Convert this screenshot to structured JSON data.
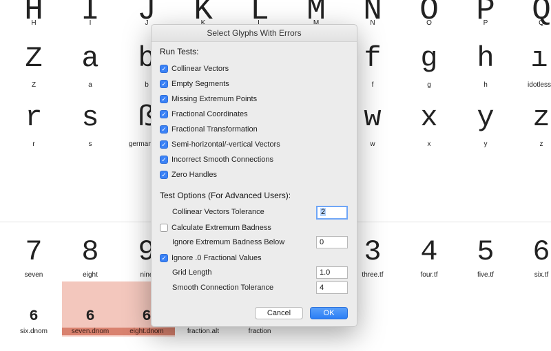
{
  "glyph_rows": {
    "top": [
      {
        "glyph": "H",
        "name": "H"
      },
      {
        "glyph": "I",
        "name": "I"
      },
      {
        "glyph": "J",
        "name": "J"
      },
      {
        "glyph": "K",
        "name": "K"
      },
      {
        "glyph": "L",
        "name": "L"
      },
      {
        "glyph": "M",
        "name": "M"
      },
      {
        "glyph": "N",
        "name": "N"
      },
      {
        "glyph": "O",
        "name": "O"
      },
      {
        "glyph": "P",
        "name": "P"
      },
      {
        "glyph": "Q",
        "name": "Q"
      }
    ],
    "second": [
      {
        "glyph": "Z",
        "name": "Z"
      },
      {
        "glyph": "a",
        "name": "a"
      },
      {
        "glyph": "b",
        "name": "b"
      },
      {
        "glyph": "f",
        "name": "f"
      },
      {
        "glyph": "g",
        "name": "g"
      },
      {
        "glyph": "h",
        "name": "h"
      },
      {
        "glyph": "ı",
        "name": "idotless"
      }
    ],
    "third": [
      {
        "glyph": "r",
        "name": "r"
      },
      {
        "glyph": "s",
        "name": "s"
      },
      {
        "glyph": "ß",
        "name": "germandbls"
      },
      {
        "glyph": "w",
        "name": "w"
      },
      {
        "glyph": "x",
        "name": "x"
      },
      {
        "glyph": "y",
        "name": "y"
      },
      {
        "glyph": "z",
        "name": "z"
      }
    ],
    "numbers": [
      {
        "glyph": "7",
        "name": "seven"
      },
      {
        "glyph": "8",
        "name": "eight"
      },
      {
        "glyph": "9",
        "name": "nine"
      },
      {
        "glyph": "3",
        "name": "three.tf"
      },
      {
        "glyph": "4",
        "name": "four.tf"
      },
      {
        "glyph": "5",
        "name": "five.tf"
      },
      {
        "glyph": "6",
        "name": "six.tf"
      }
    ],
    "denoms": [
      {
        "glyph": "6",
        "name": "six.dnom"
      },
      {
        "glyph": "6",
        "name": "seven.dnom"
      },
      {
        "glyph": "6",
        "name": "eight.dnom"
      },
      {
        "glyph": "",
        "name": "fraction.alt"
      },
      {
        "glyph": "",
        "name": "fraction"
      }
    ]
  },
  "highlight_color": "#f3c7bd",
  "dialog": {
    "title": "Select Glyphs With Errors",
    "run_tests_label": "Run Tests:",
    "tests": [
      {
        "label": "Collinear Vectors",
        "checked": true
      },
      {
        "label": "Empty Segments",
        "checked": true
      },
      {
        "label": "Missing Extremum Points",
        "checked": true
      },
      {
        "label": "Fractional Coordinates",
        "checked": true
      },
      {
        "label": "Fractional Transformation",
        "checked": true
      },
      {
        "label": "Semi-horizontal/-vertical Vectors",
        "checked": true
      },
      {
        "label": "Incorrect Smooth Connections",
        "checked": true
      },
      {
        "label": "Zero Handles",
        "checked": true
      }
    ],
    "options_label": "Test Options (For Advanced Users):",
    "options": {
      "collinear_tolerance_label": "Collinear Vectors Tolerance",
      "collinear_tolerance_value": "2",
      "calc_badness_label": "Calculate Extremum Badness",
      "calc_badness_checked": false,
      "ignore_badness_label": "Ignore Extremum Badness Below",
      "ignore_badness_value": "0",
      "ignore_fractional_label": "Ignore .0 Fractional Values",
      "ignore_fractional_checked": true,
      "grid_length_label": "Grid Length",
      "grid_length_value": "1.0",
      "smooth_tolerance_label": "Smooth Connection Tolerance",
      "smooth_tolerance_value": "4"
    },
    "cancel_label": "Cancel",
    "ok_label": "OK"
  }
}
